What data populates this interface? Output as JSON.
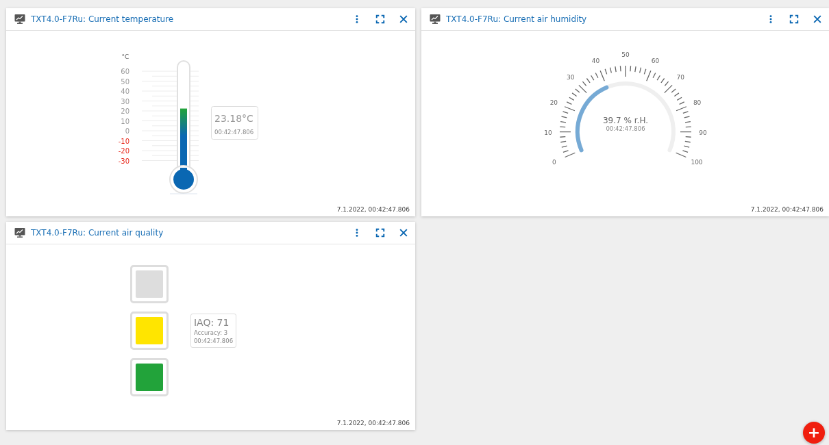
{
  "cards": [
    {
      "kind": "thermometer",
      "title": "TXT4.0-F7Ru: Current temperature",
      "unit": "°C",
      "scale": [
        {
          "label": "60",
          "color": "#999999"
        },
        {
          "label": "50",
          "color": "#999999"
        },
        {
          "label": "40",
          "color": "#999999"
        },
        {
          "label": "30",
          "color": "#999999"
        },
        {
          "label": "20",
          "color": "#999999"
        },
        {
          "label": "10",
          "color": "#999999"
        },
        {
          "label": "0",
          "color": "#999999"
        },
        {
          "label": "-10",
          "color": "#e8271a"
        },
        {
          "label": "-20",
          "color": "#e8271a"
        },
        {
          "label": "-30",
          "color": "#e8271a"
        }
      ],
      "level": 0.59,
      "reading": "23.18°C",
      "time": "00:42:47.806",
      "footer": "7.1.2022, 00:42:47.806"
    },
    {
      "kind": "gauge",
      "title": "TXT4.0-F7Ru: Current air humidity",
      "scale": [
        "0",
        "10",
        "20",
        "30",
        "40",
        "50",
        "60",
        "70",
        "80",
        "90",
        "100"
      ],
      "reading": "39.7 % r.H.",
      "time": "00:42:47.806",
      "footer": "7.1.2022, 00:42:47.806"
    },
    {
      "kind": "traffic_light",
      "title": "TXT4.0-F7Ru: Current air quality",
      "lights": [
        {
          "color": "#dddddd"
        },
        {
          "color": "#ffe500"
        },
        {
          "color": "#22a33a"
        }
      ],
      "reading": "IAQ: 71",
      "accuracy": "Accuracy: 3",
      "time": "00:42:47.806",
      "footer": "7.1.2022, 00:42:47.806"
    }
  ],
  "add_button": "+"
}
